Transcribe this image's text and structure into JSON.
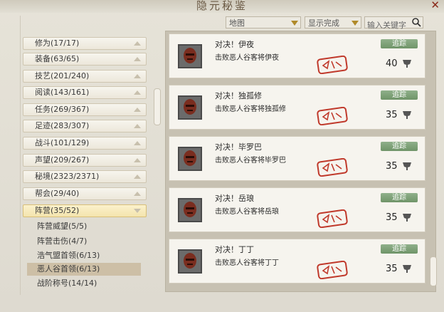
{
  "window": {
    "title": "隐元秘鉴",
    "close_icon": "close-icon"
  },
  "filters": {
    "map_dropdown": "地图",
    "status_dropdown": "显示完成",
    "search_placeholder": "输入关键字"
  },
  "categories": [
    {
      "label": "修为(17/17)"
    },
    {
      "label": "装备(63/65)"
    },
    {
      "label": "技艺(201/240)"
    },
    {
      "label": "阅读(143/161)"
    },
    {
      "label": "任务(269/367)"
    },
    {
      "label": "足迹(283/307)"
    },
    {
      "label": "战斗(101/129)"
    },
    {
      "label": "声望(209/267)"
    },
    {
      "label": "秘境(2323/2371)"
    },
    {
      "label": "帮会(29/40)"
    },
    {
      "label": "阵营(35/52)",
      "expanded": true
    }
  ],
  "subcategories": [
    {
      "label": "阵营威望(5/5)"
    },
    {
      "label": "阵营击伤(4/7)"
    },
    {
      "label": "浩气盟首领(6/13)"
    },
    {
      "label": "恶人谷首领(6/13)",
      "selected": true
    },
    {
      "label": "战阶称号(14/14)"
    }
  ],
  "achievements": [
    {
      "title": "对决！伊夜",
      "desc": "击败恶人谷客将伊夜",
      "track": "追踪",
      "points": "40"
    },
    {
      "title": "对决！独孤修",
      "desc": "击败恶人谷客将独孤修",
      "track": "追踪",
      "points": "35"
    },
    {
      "title": "对决！毕罗巴",
      "desc": "击败恶人谷客将毕罗巴",
      "track": "追踪",
      "points": "35"
    },
    {
      "title": "对决！岳琅",
      "desc": "击败恶人谷客将岳琅",
      "track": "追踪",
      "points": "35"
    },
    {
      "title": "对决！丁丁",
      "desc": "击败恶人谷客将丁丁",
      "track": "追踪",
      "points": "35"
    }
  ],
  "colors": {
    "track_button": "#7fa278",
    "stamp": "#c0392b",
    "accent": "#d8bf78"
  }
}
